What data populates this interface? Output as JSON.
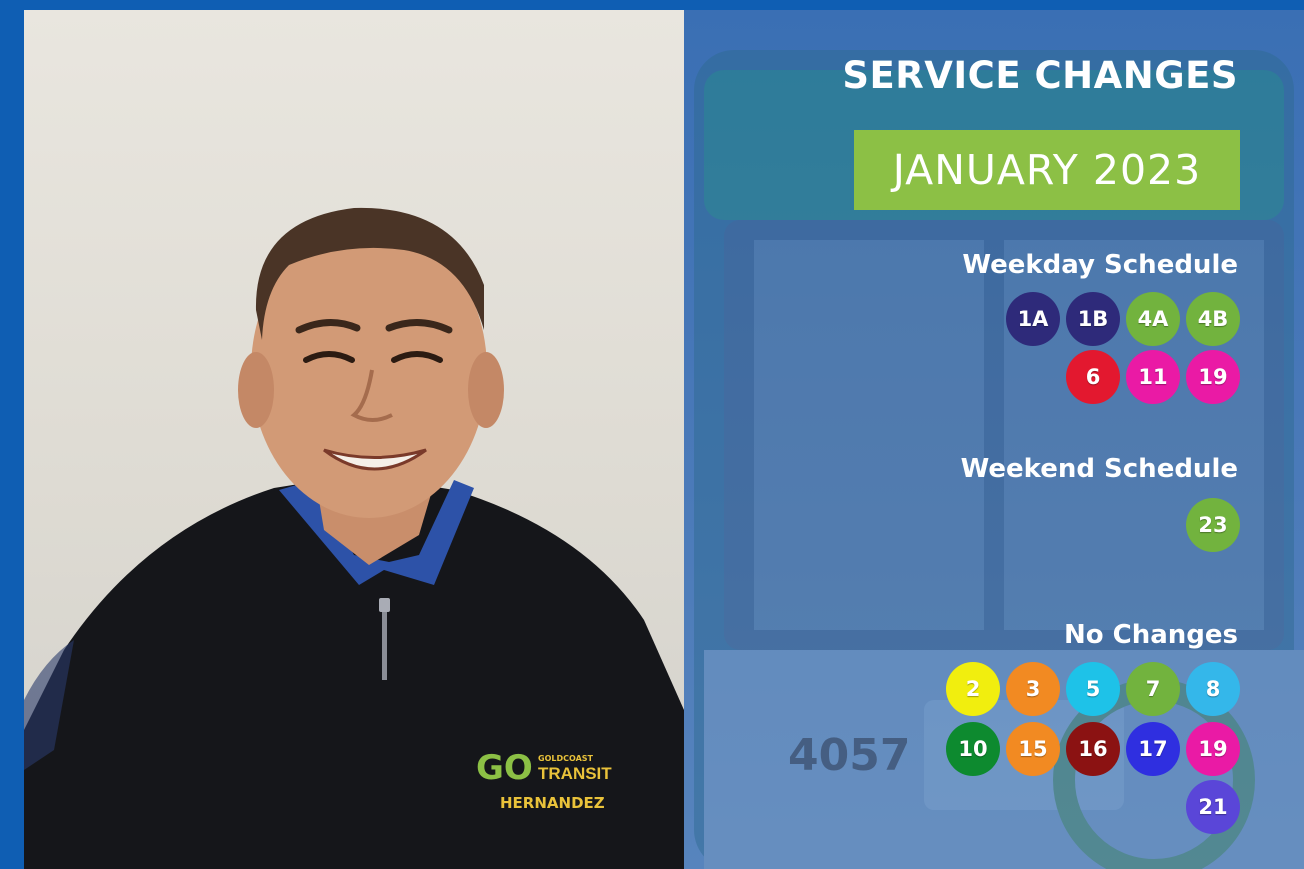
{
  "title": "SERVICE CHANGES",
  "month": "JANUARY 2023",
  "bus_number": "4057",
  "logo": {
    "brand": "GO",
    "line1": "GOLDCOAST",
    "line2": "TRANSIT",
    "name": "HERNANDEZ"
  },
  "weekday": {
    "title": "Weekday Schedule",
    "row1": [
      {
        "label": "1A",
        "color": "#2e2a7a"
      },
      {
        "label": "1B",
        "color": "#2e2a7a"
      },
      {
        "label": "4A",
        "color": "#72b33e"
      },
      {
        "label": "4B",
        "color": "#72b33e"
      }
    ],
    "row2": [
      {
        "label": "6",
        "color": "#e3182f"
      },
      {
        "label": "11",
        "color": "#ea1aa5"
      },
      {
        "label": "19",
        "color": "#ea1aa5"
      }
    ]
  },
  "weekend": {
    "title": "Weekend Schedule",
    "row1": [
      {
        "label": "23",
        "color": "#72b33e"
      }
    ]
  },
  "no_changes": {
    "title": "No Changes",
    "row1": [
      {
        "label": "2",
        "color": "#f1ee0e"
      },
      {
        "label": "3",
        "color": "#f28a22"
      },
      {
        "label": "5",
        "color": "#1ec2e8"
      },
      {
        "label": "7",
        "color": "#72b33e"
      },
      {
        "label": "8",
        "color": "#34b7ea"
      }
    ],
    "row2": [
      {
        "label": "10",
        "color": "#0d8a2f"
      },
      {
        "label": "15",
        "color": "#f28a22"
      },
      {
        "label": "16",
        "color": "#8b1212"
      },
      {
        "label": "17",
        "color": "#2f2fe0"
      },
      {
        "label": "19",
        "color": "#ea1aa5"
      }
    ],
    "row3": [
      {
        "label": "21",
        "color": "#5a46d8"
      }
    ]
  }
}
